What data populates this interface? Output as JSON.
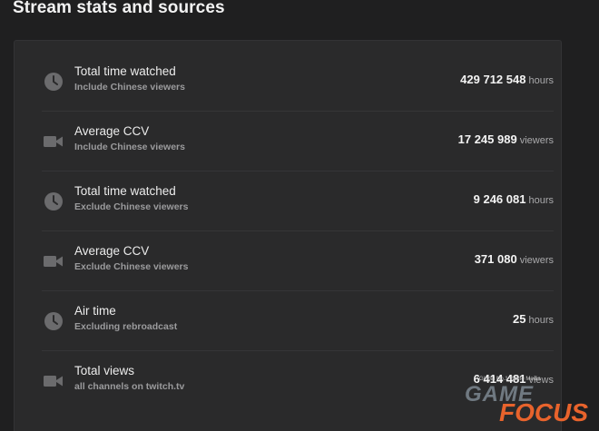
{
  "page": {
    "title": "Stream stats and sources"
  },
  "stats": [
    {
      "icon": "clock-icon",
      "label": "Total time watched",
      "sublabel": "Include Chinese viewers",
      "value": "429 712 548",
      "unit": "hours"
    },
    {
      "icon": "video-camera-icon",
      "label": "Average CCV",
      "sublabel": "Include Chinese viewers",
      "value": "17 245 989",
      "unit": "viewers"
    },
    {
      "icon": "clock-icon",
      "label": "Total time watched",
      "sublabel": "Exclude Chinese viewers",
      "value": "9 246 081",
      "unit": "hours"
    },
    {
      "icon": "video-camera-icon",
      "label": "Average CCV",
      "sublabel": "Exclude Chinese viewers",
      "value": "371 080",
      "unit": "viewers"
    },
    {
      "icon": "clock-icon",
      "label": "Air time",
      "sublabel": "Excluding rebroadcast",
      "value": "25",
      "unit": "hours"
    },
    {
      "icon": "video-camera-icon",
      "label": "Total views",
      "sublabel": "all channels on twitch.tv",
      "value": "6 414 481",
      "unit": "views"
    }
  ],
  "watermark": {
    "tagline": "Global No.1 Game Media",
    "word1": "GAME",
    "word2": "FOCUS"
  },
  "colors": {
    "background": "#1f1f20",
    "panel": "#2a2a2b",
    "accent": "#e8632c"
  }
}
